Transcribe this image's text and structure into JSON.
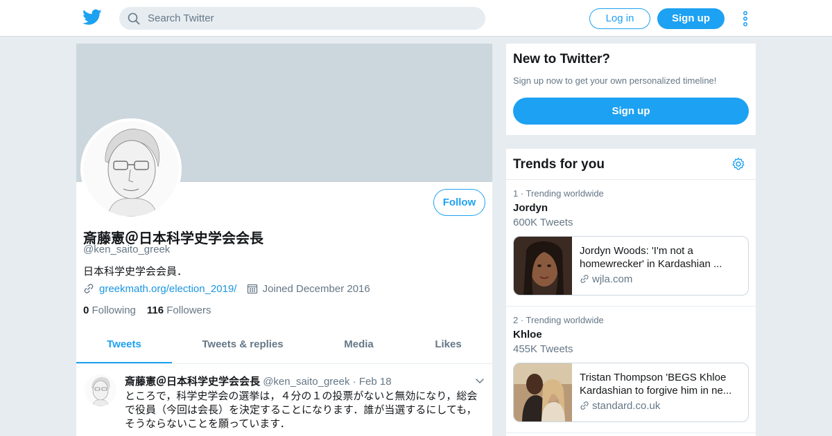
{
  "colors": {
    "accent": "#1da1f2",
    "link": "#1b95e0",
    "muted": "#657786",
    "page_bg": "#e6ecf0",
    "banner": "#ccd6dd"
  },
  "header": {
    "search_placeholder": "Search Twitter",
    "login_label": "Log in",
    "signup_label": "Sign up",
    "icons": [
      "twitter-bird-icon",
      "search-icon",
      "more-vertical-icon"
    ]
  },
  "profile": {
    "follow_label": "Follow",
    "name": "斎藤憲＠日本科学史学会会長",
    "handle": "@ken_saito_greek",
    "bio": "日本科学史学会会員．",
    "url": "greekmath.org/election_2019/",
    "joined": "Joined December 2016",
    "following_count": "0",
    "following_label": "Following",
    "followers_count": "116",
    "followers_label": "Followers",
    "tabs": [
      {
        "label": "Tweets",
        "active": true
      },
      {
        "label": "Tweets & replies",
        "active": false
      },
      {
        "label": "Media",
        "active": false
      },
      {
        "label": "Likes",
        "active": false
      }
    ]
  },
  "tweet": {
    "name": "斎藤憲＠日本科学史学会会長",
    "handle": "@ken_saito_greek",
    "sep": "·",
    "date": "Feb 18",
    "text": "ところで，科学史学会の選挙は，４分の１の投票がないと無効になり，総会で役員（今回は会長）を決定することになります．誰が当選するにしても，そうならないことを願っています．"
  },
  "new_to_twitter": {
    "title": "New to Twitter?",
    "subtitle": "Sign up now to get your own personalized timeline!",
    "button": "Sign up"
  },
  "trends": {
    "title": "Trends for you",
    "items": [
      {
        "context": "1 · Trending worldwide",
        "name": "Jordyn",
        "count": "600K Tweets",
        "card_title": "Jordyn Woods: 'I'm not a homewrecker' in Kardashian ...",
        "card_domain": "wjla.com"
      },
      {
        "context": "2 · Trending worldwide",
        "name": "Khloe",
        "count": "455K Tweets",
        "card_title": "Tristan Thompson 'BEGS Khloe Kardashian to forgive him in ne...",
        "card_domain": "standard.co.uk"
      }
    ]
  }
}
